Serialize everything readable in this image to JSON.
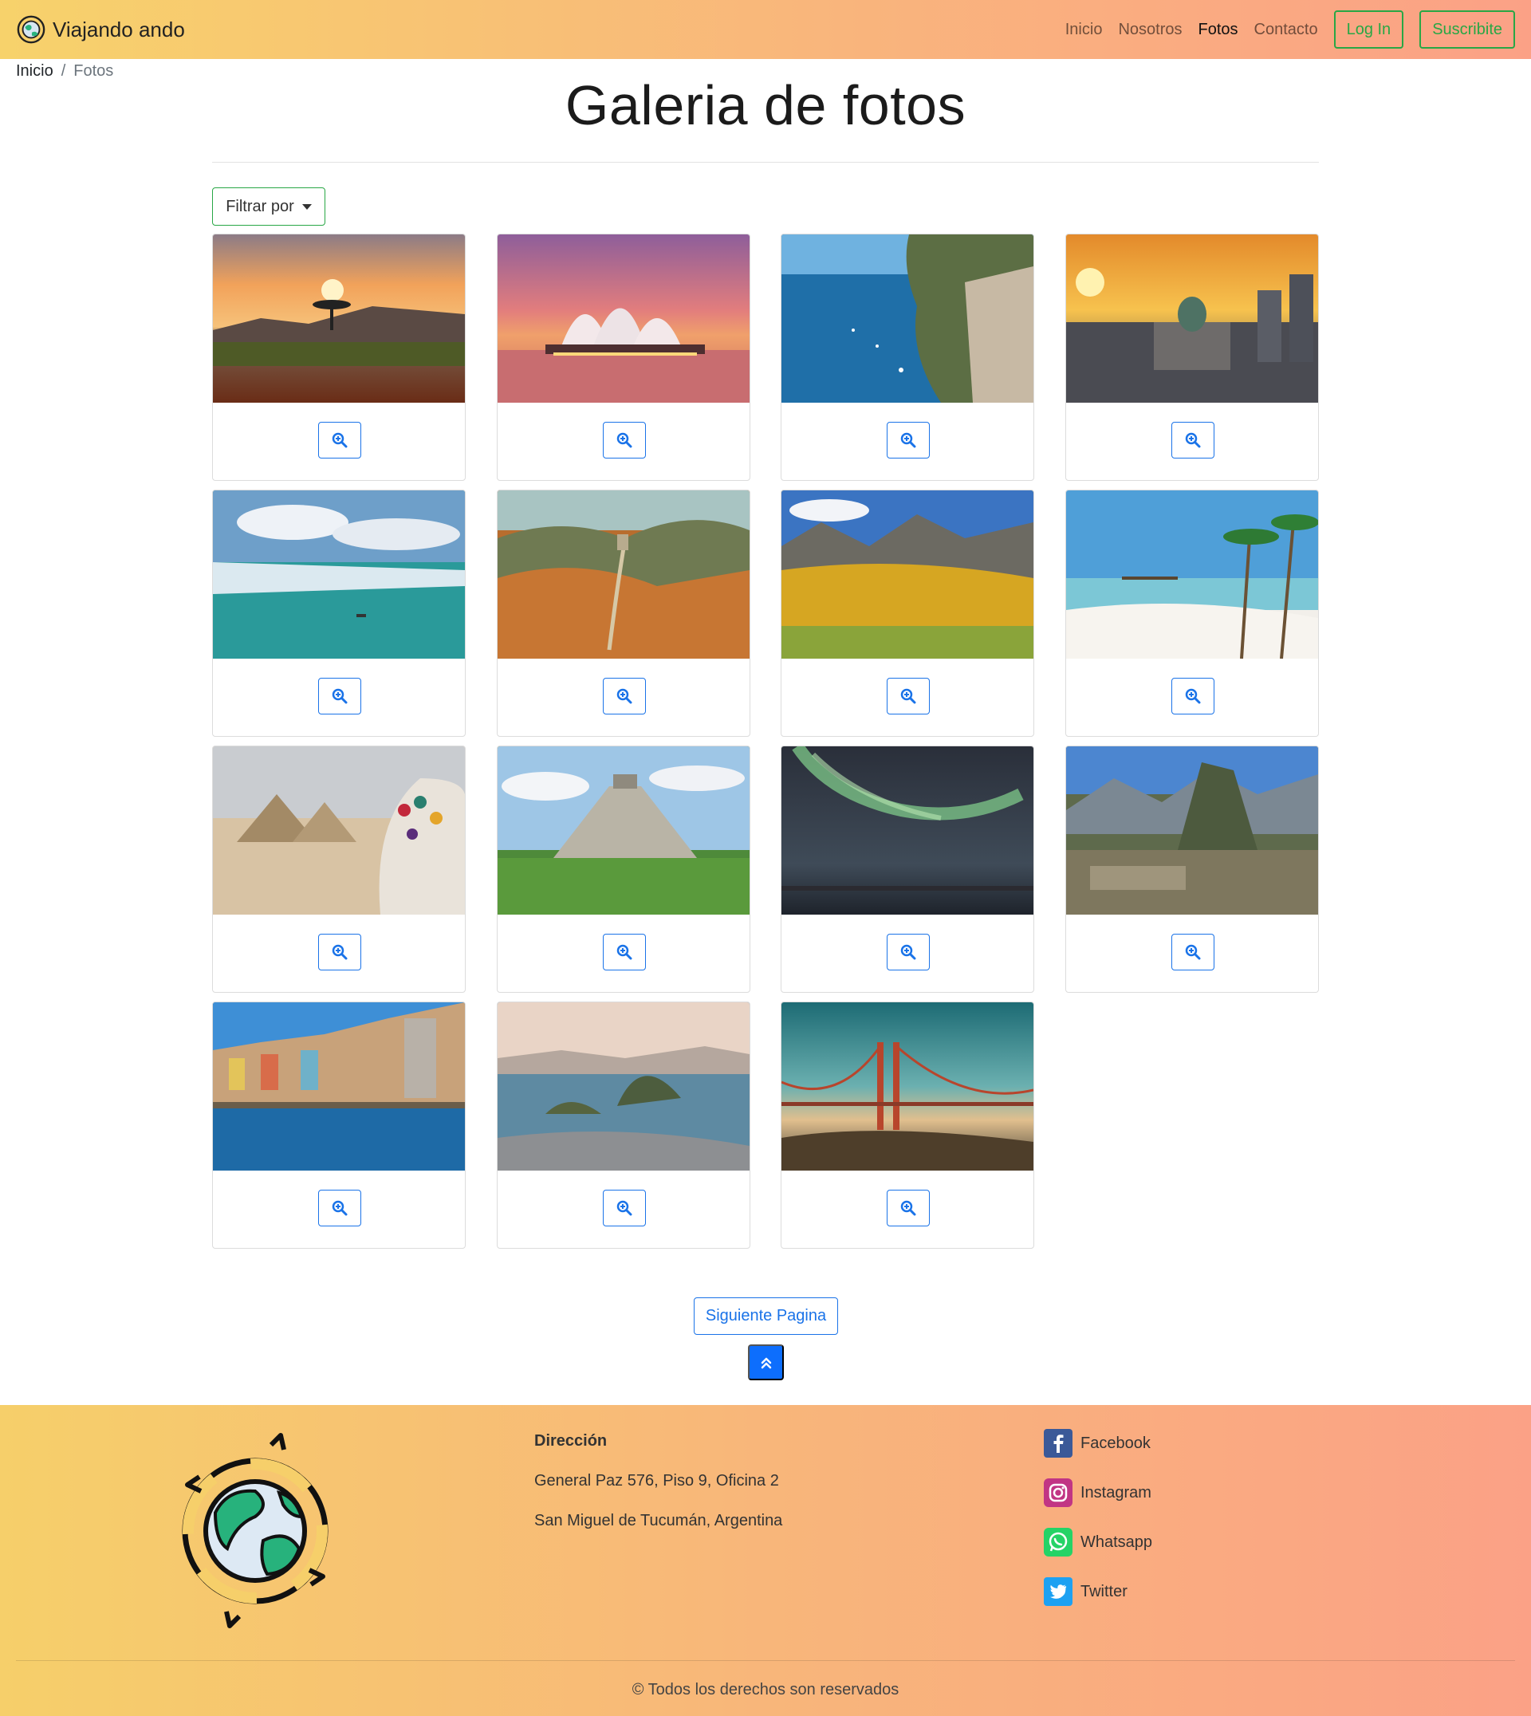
{
  "navbar": {
    "brand": "Viajando ando",
    "links": [
      "Inicio",
      "Nosotros",
      "Fotos",
      "Contacto"
    ],
    "active_link": "Fotos",
    "login_label": "Log In",
    "subscribe_label": "Suscribite"
  },
  "breadcrumb": {
    "home": "Inicio",
    "separator": "/",
    "current": "Fotos"
  },
  "page": {
    "title": "Galeria de fotos",
    "filter_label": "Filtrar por"
  },
  "gallery": {
    "photos": [
      "sunset-savanna",
      "sydney-opera-house",
      "amalfi-coast",
      "buenos-aires-congress",
      "perito-moreno-glacier",
      "great-wall",
      "autumn-mountains",
      "tropical-beach",
      "giza-pyramids",
      "chichen-itza",
      "aurora-borealis",
      "machu-picchu",
      "porto-riverside",
      "rio-de-janeiro",
      "golden-gate-bridge"
    ],
    "zoom_icon": "zoom-in-icon"
  },
  "pagination": {
    "next_label": "Siguiente Pagina",
    "top_icon": "double-chevron-up-icon"
  },
  "footer": {
    "address_title": "Dirección",
    "address_lines": [
      "General Paz 576, Piso 9, Oficina 2",
      "San Miguel de Tucumán, Argentina"
    ],
    "social": [
      "Facebook",
      "Instagram",
      "Whatsapp",
      "Twitter"
    ],
    "copyright": "© Todos los derechos son reservados"
  },
  "colors": {
    "accent_green": "#28a745",
    "accent_blue": "#1a73e8",
    "primary": "#0d6efd"
  }
}
